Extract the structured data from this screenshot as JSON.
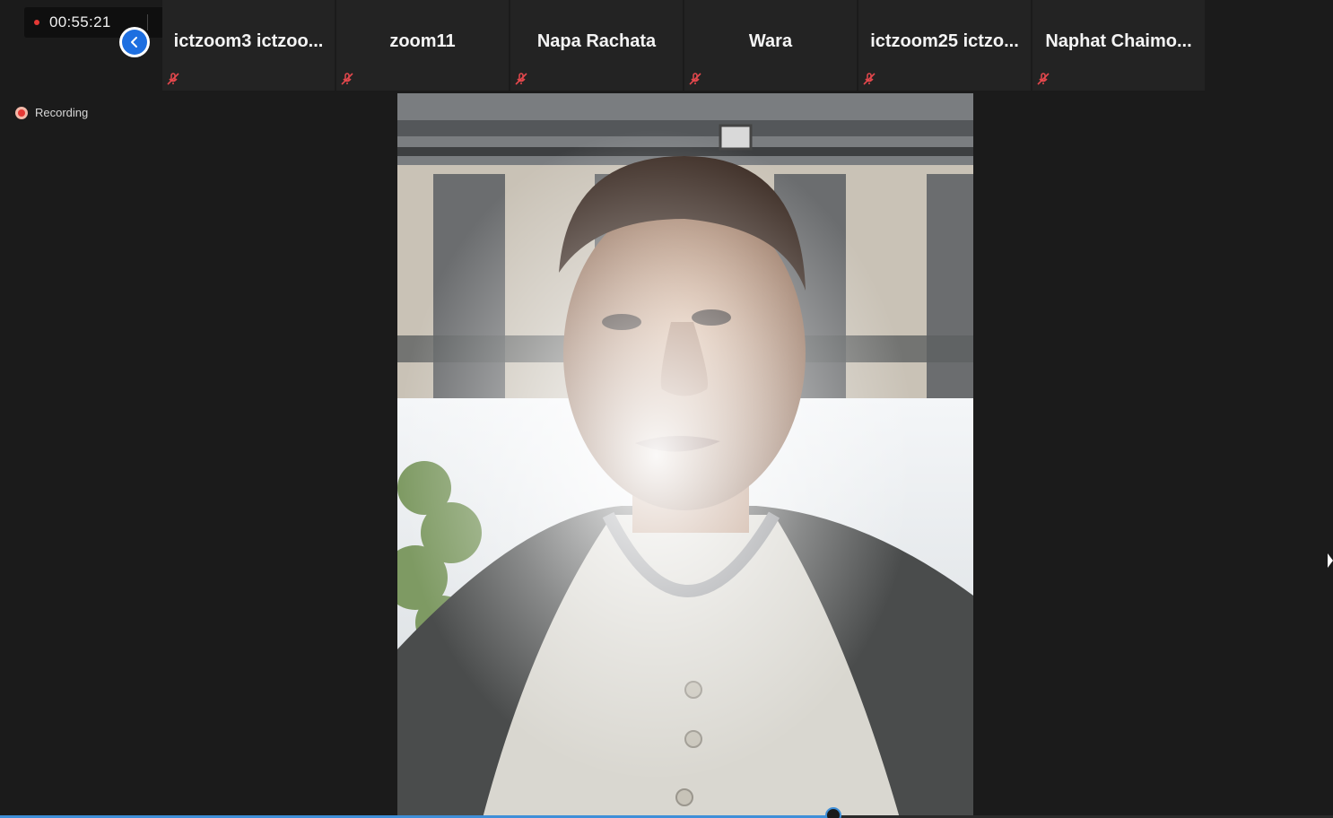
{
  "timer": {
    "elapsed": "00:55:21"
  },
  "recording": {
    "label": "Recording"
  },
  "participants": [
    {
      "name": "ictzoom3  ictzoo...",
      "muted": true
    },
    {
      "name": "zoom11",
      "muted": true
    },
    {
      "name": "Napa Rachata",
      "muted": true
    },
    {
      "name": "Wara",
      "muted": true
    },
    {
      "name": "ictzoom25  ictzo...",
      "muted": true
    },
    {
      "name": "Naphat  Chaimo...",
      "muted": true
    }
  ],
  "colors": {
    "accent": "#1e6fe0",
    "record": "#e53935",
    "mute": "#e5484d",
    "progress": "#3f8fd8"
  },
  "icons": {
    "collapse": "chevron-left-icon",
    "mute": "mic-muted-icon",
    "stop": "stop-recording-icon"
  },
  "playback": {
    "progress": 0.625
  }
}
